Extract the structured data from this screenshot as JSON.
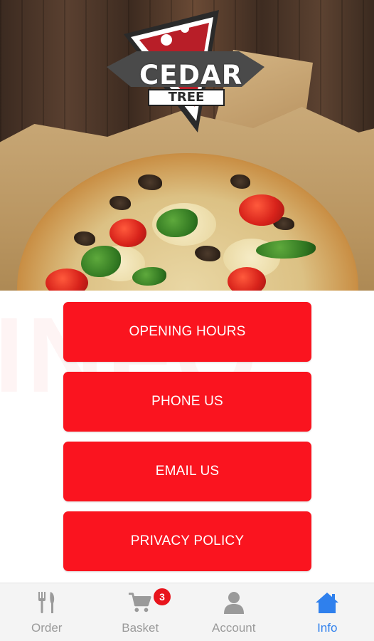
{
  "brand": {
    "name_line1": "CEDAR",
    "name_line2": "TREE"
  },
  "watermark_text": "INFO",
  "menu": {
    "opening_hours": "OPENING HOURS",
    "phone_us": "PHONE US",
    "email_us": "EMAIL US",
    "privacy_policy": "PRIVACY POLICY"
  },
  "nav": {
    "order": "Order",
    "basket": "Basket",
    "basket_count": "3",
    "account": "Account",
    "info": "Info",
    "active": "info"
  },
  "colors": {
    "button_red": "#fa141f",
    "active_blue": "#2f80ed",
    "inactive_gray": "#9a9a9a",
    "badge_red": "#e8141c"
  },
  "icons": {
    "order": "fork-knife-icon",
    "basket": "cart-icon",
    "account": "person-icon",
    "info": "home-icon"
  }
}
